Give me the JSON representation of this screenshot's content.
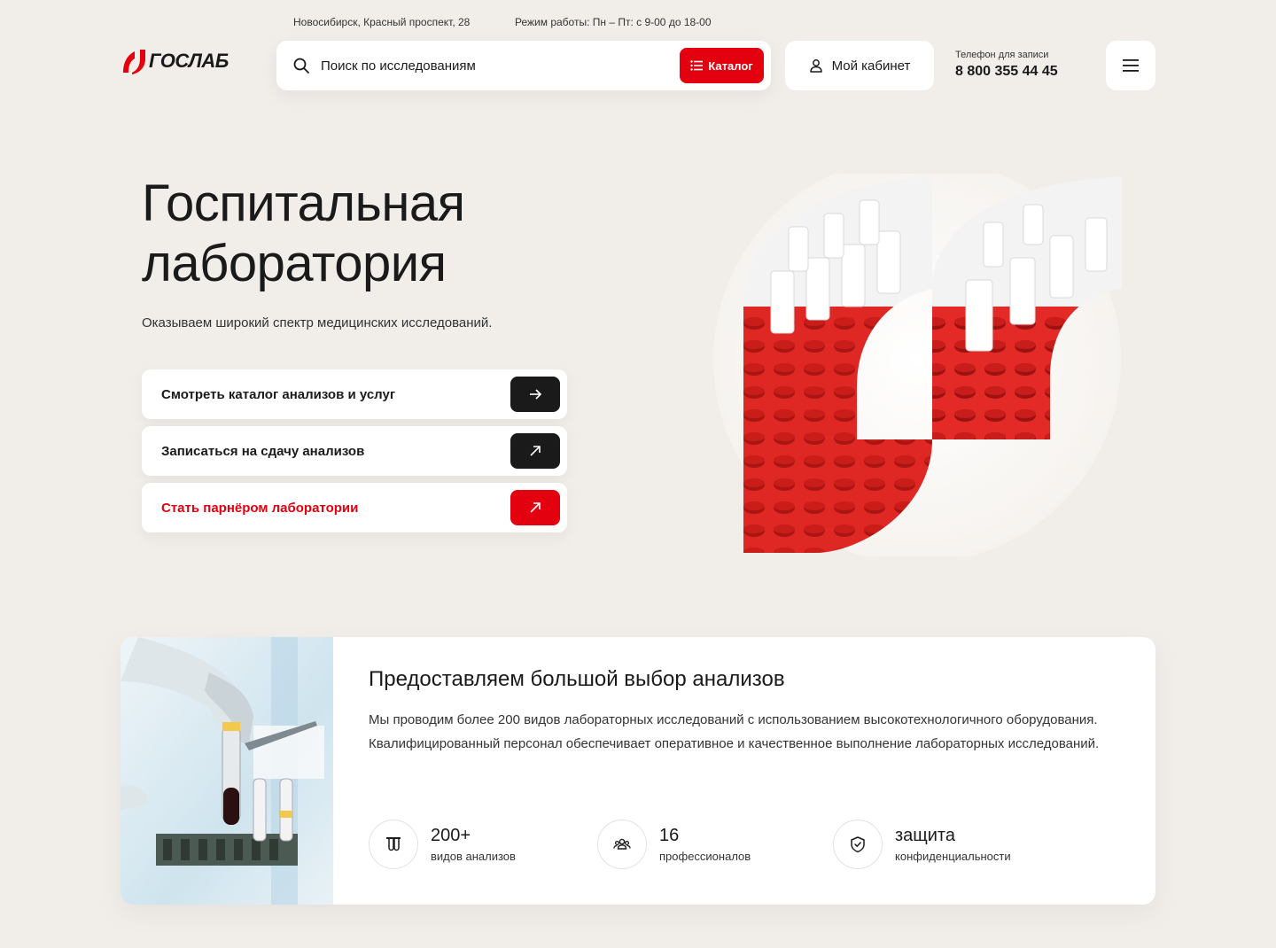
{
  "header": {
    "address": "Новосибирск, Красный проспект, 28",
    "hours": "Режим работы: Пн – Пт: с 9-00 до 18-00",
    "logo_text": "ГОСЛАБ",
    "search_placeholder": "Поиск по исследованиям",
    "catalog_label": "Каталог",
    "cabinet_label": "Мой кабинет",
    "phone_label": "Телефон для записи",
    "phone_number": "8 800 355 44 45"
  },
  "hero": {
    "title_line1": "Госпитальная",
    "title_line2": "лаборатория",
    "subtitle": "Оказываем широкий спектр медицинских исследований.",
    "actions": [
      {
        "label": "Смотреть каталог анализов и услуг",
        "icon": "arrow-right-icon"
      },
      {
        "label": "Записаться на сдачу анализов",
        "icon": "arrow-up-right-icon"
      },
      {
        "label": "Стать парнёром лаборатории",
        "icon": "arrow-up-right-icon"
      }
    ]
  },
  "info": {
    "title": "Предоставляем большой выбор анализов",
    "text": "Мы проводим более 200 видов лабораторных исследований с использованием высокотехнологичного оборудования. Квалифицированный персонал обеспечивает оперативное и качественное выполнение лабораторных исследований.",
    "stats": [
      {
        "value": "200+",
        "label": "видов анализов",
        "icon": "test-tubes-icon"
      },
      {
        "value": "16",
        "label": "профессионалов",
        "icon": "people-icon"
      },
      {
        "value": "защита",
        "label": "конфиденциальности",
        "icon": "shield-icon"
      }
    ]
  },
  "colors": {
    "accent": "#e3000f",
    "background": "#f1eeea",
    "dark": "#1a1a1a"
  }
}
